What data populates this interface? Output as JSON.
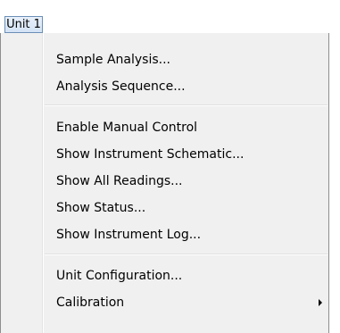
{
  "menubar": {
    "unit_label": "Unit 1"
  },
  "menu": {
    "group1": [
      {
        "label": "Sample Analysis..."
      },
      {
        "label": "Analysis Sequence..."
      }
    ],
    "group2": [
      {
        "label": "Enable Manual Control"
      },
      {
        "label": "Show Instrument Schematic..."
      },
      {
        "label": "Show All Readings..."
      },
      {
        "label": "Show Status..."
      },
      {
        "label": "Show Instrument Log..."
      }
    ],
    "group3": [
      {
        "label": "Unit Configuration..."
      },
      {
        "label": "Calibration",
        "submenu": true
      }
    ]
  }
}
